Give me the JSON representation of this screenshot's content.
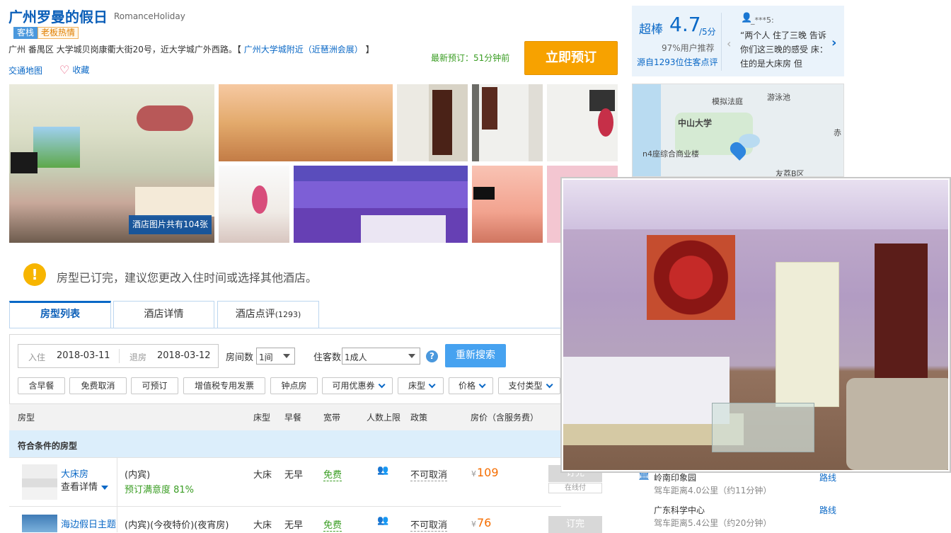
{
  "hotel": {
    "name": "广州罗曼的假日",
    "name_en": "RomanceHoliday",
    "tags": [
      "客栈",
      "老板热情"
    ],
    "address": "广州 番禺区 大学城贝岗康衢大街20号，近大学城广外西路。【",
    "address_link": "广州大学城附近（近琶洲会展）",
    "address_close": "】",
    "map_link": "交通地图",
    "favorite": "收藏",
    "latest_booking": "最新预订：51分钟前",
    "book_now": "立即预订",
    "photo_count": "酒店图片共有104张"
  },
  "notice": "房型已订完，建议您更改入住时间或选择其他酒店。",
  "tabs": [
    "房型列表",
    "酒店详情",
    "酒店点评",
    "(1293)"
  ],
  "search": {
    "checkin_label": "入住",
    "checkin": "2018-03-11",
    "checkout_label": "退房",
    "checkout": "2018-03-12",
    "rooms_label": "房间数",
    "rooms": "1间",
    "guests_label": "住客数",
    "guests": "1成人",
    "help": "?",
    "button": "重新搜索"
  },
  "filters": [
    "含早餐",
    "免费取消",
    "可预订",
    "增值税专用发票",
    "钟点房",
    "可用优惠券",
    "床型",
    "价格",
    "支付类型"
  ],
  "table": {
    "headers": [
      "房型",
      "床型",
      "早餐",
      "宽带",
      "人数上限",
      "政策",
      "房价（含服务费）"
    ],
    "group": "符合条件的房型",
    "rows": [
      {
        "name": "大床房",
        "detail": "查看详情",
        "source": "(内宾)",
        "satisfaction": "预订满意度 81%",
        "bed": "大床",
        "breakfast": "无早",
        "broadband": "免费",
        "policy": "不可取消",
        "price": "109",
        "book": "订完",
        "book_sub": "在线付"
      },
      {
        "name": "海边假日主题",
        "source": "(内宾)(今夜特价)(夜宵房)",
        "bed": "大床",
        "breakfast": "无早",
        "broadband": "免费",
        "policy": "不可取消",
        "price": "76",
        "book": "订完"
      }
    ]
  },
  "rating": {
    "word": "超棒",
    "score": "4.7",
    "out_of": "/5分",
    "recommend": "97%用户推荐",
    "from": "源自1293位住客点评",
    "user": "_***5:",
    "review": "“两个人 住了三晚 告诉你们这三晚的感受 床：住的是大床房 但"
  },
  "map": {
    "labels": [
      "模拟法庭",
      "游泳池",
      "中山大学",
      "赤",
      "n4座综合商业楼",
      "友荔B区"
    ]
  },
  "nearby": [
    {
      "name": "岭南印象园",
      "distance": "驾车距离4.0公里（约11分钟）",
      "route": "路线"
    },
    {
      "name": "广东科学中心",
      "distance": "驾车距离5.4公里（约20分钟）",
      "route": "路线"
    }
  ],
  "currency": "¥"
}
